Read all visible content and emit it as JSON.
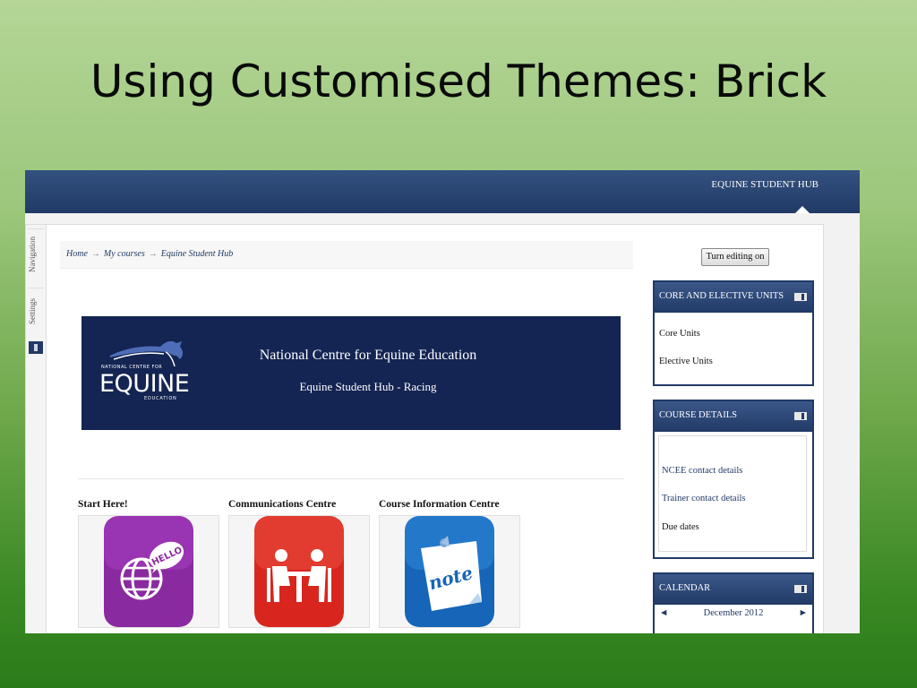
{
  "slide": {
    "title": "Using Customised Themes: Brick"
  },
  "topbar": {
    "hub_link": "EQUINE STUDENT HUB"
  },
  "dock": {
    "navigation": "Navigation",
    "settings": "Settings"
  },
  "breadcrumb": {
    "home": "Home",
    "sep": "→",
    "my_courses": "My courses",
    "current": "Equine Student Hub"
  },
  "banner": {
    "logo_small": "NATIONAL CENTRE FOR",
    "logo_main": "EQUINE",
    "logo_sub": "EDUCATION",
    "title": "National Centre for Equine Education",
    "subtitle": "Equine Student Hub - Racing",
    "background": "#142453"
  },
  "tiles": [
    {
      "label": "Start Here!",
      "icon": "hello-globe-icon",
      "color": "#8a2aa0"
    },
    {
      "label": "Communications Centre",
      "icon": "meeting-people-icon",
      "color": "#d8261f"
    },
    {
      "label": "Course Information Centre",
      "icon": "note-icon",
      "color": "#1665b8"
    }
  ],
  "edit_button": "Turn editing on",
  "blocks": {
    "core": {
      "title": "CORE AND ELECTIVE UNITS",
      "items": [
        "Core Units",
        "Elective Units"
      ]
    },
    "course": {
      "title": "COURSE DETAILS",
      "items": [
        "NCEE contact details",
        "Trainer contact details",
        "Due dates"
      ]
    },
    "calendar": {
      "title": "CALENDAR",
      "month": "December 2012",
      "prev": "◄",
      "next": "►"
    }
  },
  "colors": {
    "theme_navy": "#213a66",
    "slide_green": "#3c8a25"
  }
}
